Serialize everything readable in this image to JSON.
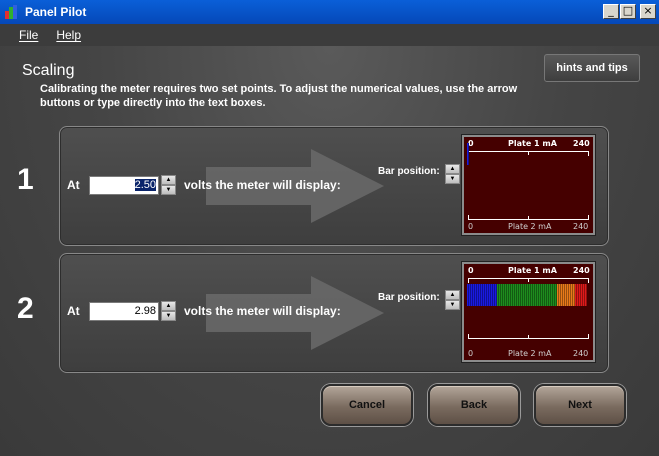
{
  "window": {
    "title": "Panel Pilot"
  },
  "menu": {
    "items": [
      "File",
      "Help"
    ]
  },
  "page": {
    "title": "Scaling",
    "instructions": "Calibrating the meter requires two set points. To adjust the numerical values, use the arrow buttons or type directly into the text boxes.",
    "hints_button": "hints and tips"
  },
  "setpoints": [
    {
      "number": "1",
      "at_label": "At",
      "volts_value": "2.50",
      "display_label": "volts the meter will display:",
      "bar_position_label": "Bar position:",
      "meter": {
        "upper_min": "0",
        "upper_title": "Plate 1 mA",
        "upper_max": "240",
        "lower_min": "0",
        "lower_title": "Plate 2 mA",
        "lower_max": "240",
        "bar_fill_fraction": 0.02
      }
    },
    {
      "number": "2",
      "at_label": "At",
      "volts_value": "2.98",
      "display_label": "volts the meter will display:",
      "bar_position_label": "Bar position:",
      "meter": {
        "upper_min": "0",
        "upper_title": "Plate 1 mA",
        "upper_max": "240",
        "lower_min": "0",
        "lower_title": "Plate 2 mA",
        "lower_max": "240",
        "bar_fill_fraction": 1.0
      }
    }
  ],
  "buttons": {
    "cancel": "Cancel",
    "back": "Back",
    "next": "Next"
  },
  "colors": {
    "bar_blue": "#1a1ae0",
    "bar_green": "#1e8c1e",
    "bar_orange": "#e87a1a",
    "bar_red": "#e01a1a",
    "meter_bg": "#450000"
  }
}
